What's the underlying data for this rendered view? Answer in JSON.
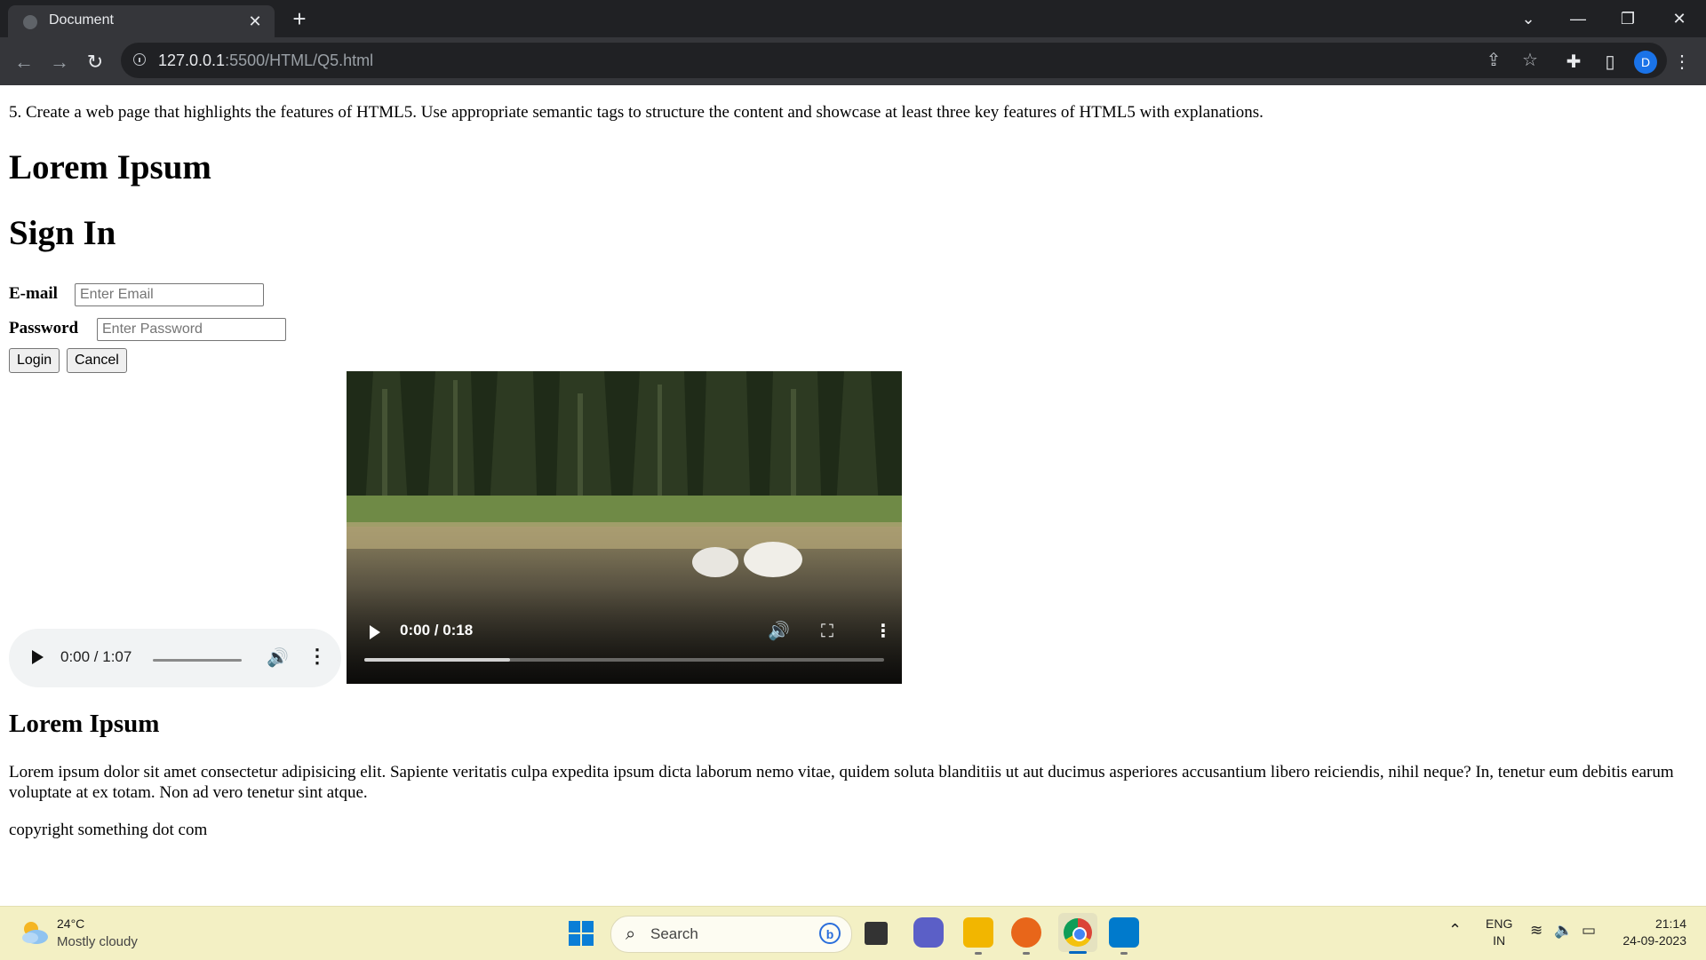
{
  "browser": {
    "tab_title": "Document",
    "url_host": "127.0.0.1",
    "url_path": ":5500/HTML/Q5.html",
    "avatar_letter": "D"
  },
  "page": {
    "intro": "5. Create a web page that highlights the features of HTML5. Use appropriate semantic tags to structure the content and showcase at least three key features of HTML5 with explanations.",
    "title": "Lorem Ipsum",
    "signin_heading": "Sign In",
    "form": {
      "email_label": "E-mail",
      "email_placeholder": "Enter Email",
      "password_label": "Password",
      "password_placeholder": "Enter Password",
      "login_label": "Login",
      "cancel_label": "Cancel"
    },
    "audio": {
      "time": "0:00 / 1:07"
    },
    "video": {
      "time": "0:00 / 0:18",
      "buffered_fraction": 0.28
    },
    "section_heading": "Lorem Ipsum",
    "paragraph": "Lorem ipsum dolor sit amet consectetur adipisicing elit. Sapiente veritatis culpa expedita ipsum dicta laborum nemo vitae, quidem soluta blanditiis ut aut ducimus asperiores accusantium libero reiciendis, nihil neque? In, tenetur eum debitis earum voluptate at ex totam. Non ad vero tenetur sint atque.",
    "footer": "copyright something dot com"
  },
  "taskbar": {
    "weather_temp": "24°C",
    "weather_desc": "Mostly cloudy",
    "search_label": "Search",
    "lang_line1": "ENG",
    "lang_line2": "IN",
    "time": "21:14",
    "date": "24-09-2023"
  },
  "colors": {
    "chrome_dark": "#202124",
    "toolbar": "#35363a",
    "taskbar": "#f3f0c4",
    "accent": "#1a73e8"
  }
}
